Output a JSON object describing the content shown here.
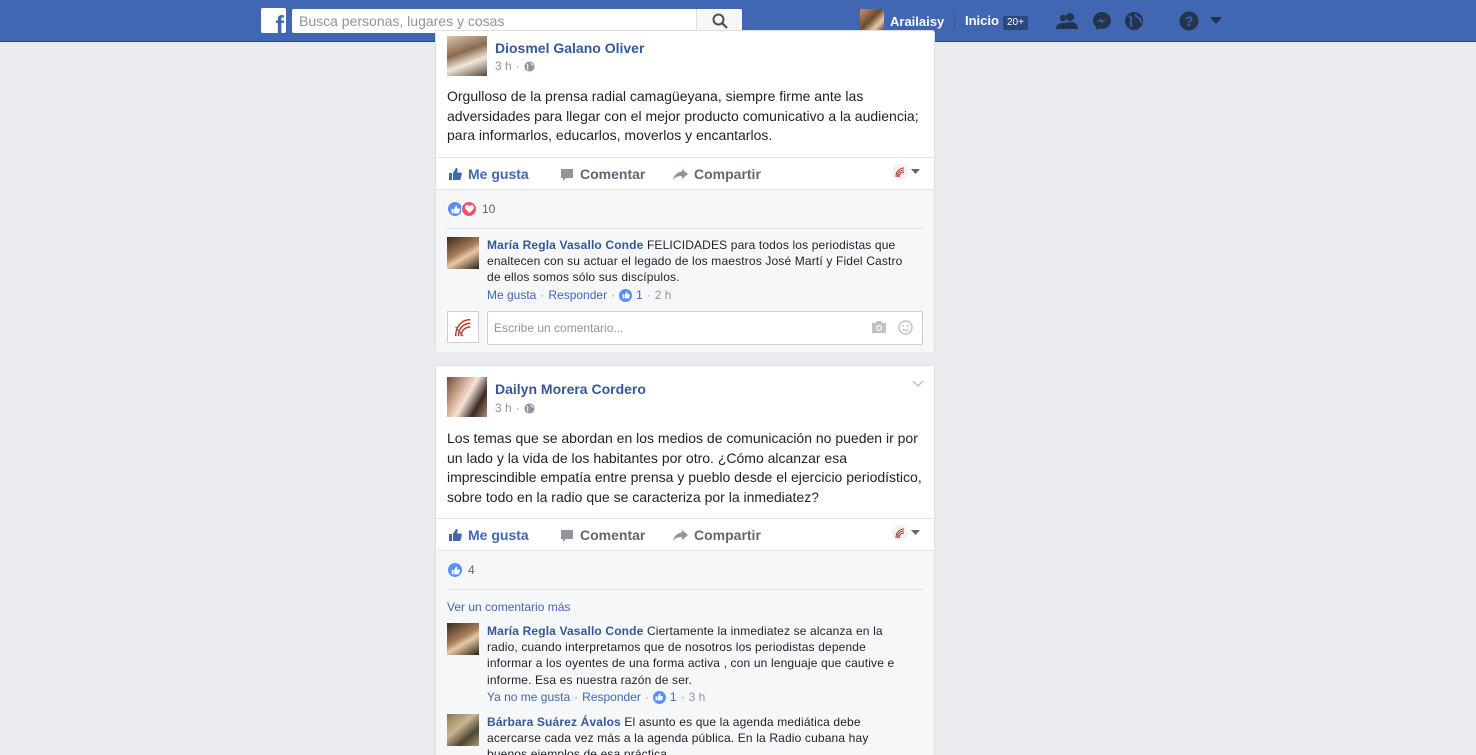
{
  "topbar": {
    "logo": "f",
    "search_placeholder": "Busca personas, lugares y cosas",
    "user_name": "Arailaisy",
    "home_label": "Inicio",
    "home_badge": "20+",
    "icons": [
      "friends-icon",
      "messenger-icon",
      "globe-icon",
      "help-icon",
      "dropdown-arrow-icon"
    ]
  },
  "posts": [
    {
      "author": "Diosmel Galano Oliver",
      "time": "3 h",
      "privacy_icon": "globe-icon",
      "text": "Orgulloso de la prensa radial camagüeyana, siempre firme ante las adversidades para llegar con el mejor producto comunicativo a la audiencia; para informarlos, educarlos, moverlos y encantarlos.",
      "actions": {
        "like": "Me gusta",
        "comment": "Comentar",
        "share": "Compartir"
      },
      "reaction_count": "10",
      "reactions": [
        "like",
        "love"
      ],
      "comments": [
        {
          "name": "María Regla Vasallo Conde",
          "text": "FELICIDADES para todos los periodistas que enaltecen con su actuar el legado de los maestros José Martí y Fidel Castro de ellos somos sólo sus discípulos.",
          "like_label": "Me gusta",
          "reply_label": "Responder",
          "likes": "1",
          "time": "2 h"
        }
      ],
      "write_placeholder": "Escribe un comentario..."
    },
    {
      "author": "Dailyn Morera Cordero",
      "time": "3 h",
      "privacy_icon": "globe-icon",
      "text": "Los temas que se abordan en los medios de comunicación no pueden ir por un lado y la vida de los habitantes por otro. ¿Cómo alcanzar esa imprescindible empatía entre prensa y pueblo desde el ejercicio periodístico, sobre todo en la radio que se caracteriza por la inmediatez?",
      "actions": {
        "like": "Me gusta",
        "comment": "Comentar",
        "share": "Compartir"
      },
      "reaction_count": "4",
      "reactions": [
        "like"
      ],
      "more_comments": "Ver un comentario más",
      "comments": [
        {
          "name": "María Regla Vasallo Conde",
          "text": "Ciertamente la inmediatez se alcanza en la radio, cuando interpretamos que de nosotros los periodistas depende informar a los oyentes de una forma activa , con un lenguaje que cautive e informe. Esa es nuestra razón de ser.",
          "like_label": "Ya no me gusta",
          "reply_label": "Responder",
          "likes": "1",
          "time": "3 h"
        },
        {
          "name": "Bárbara Suárez Ávalos",
          "text": "El asunto es que la agenda mediática debe acercarse cada vez más a la agenda pública. En la Radio cubana hay buenos ejemplos de esa práctica."
        }
      ]
    }
  ],
  "colors": {
    "brand": "#4267b2",
    "link": "#365899",
    "background": "#e9ebee",
    "love": "#f25268"
  }
}
